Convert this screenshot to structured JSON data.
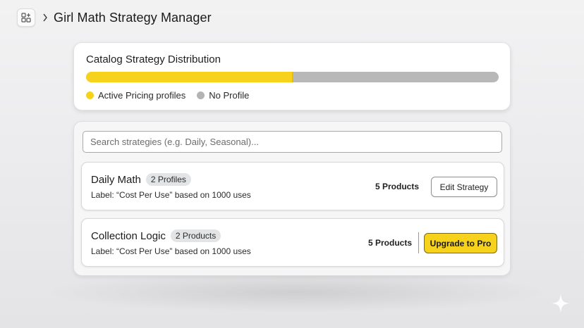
{
  "header": {
    "app_icon": "grid-plus-icon",
    "separator_icon": "chevron-right-icon",
    "title": "Girl Math Strategy Manager"
  },
  "distribution": {
    "title": "Catalog Strategy Distribution",
    "active_fraction": 0.5,
    "legend": [
      {
        "label": "Active Pricing profiles",
        "color": "#f7d21c"
      },
      {
        "label": "No Profile",
        "color": "#b3b3b3"
      }
    ]
  },
  "search": {
    "placeholder": "Search strategies (e.g. Daily, Seasonal)...",
    "value": ""
  },
  "strategies": [
    {
      "name": "Daily Math",
      "badge": "2 Profiles",
      "label": "Label: “Cost Per Use” based on 1000 uses",
      "count": "5 Products",
      "action": "Edit Strategy"
    },
    {
      "name": "Collection Logic",
      "badge": "2 Products",
      "label": "Label: “Cost Per Use” based on 1000 uses",
      "count": "5 Products",
      "action": "Upgrade to Pro"
    }
  ],
  "colors": {
    "accent": "#f7d21c",
    "inactive": "#b8b8b8"
  }
}
